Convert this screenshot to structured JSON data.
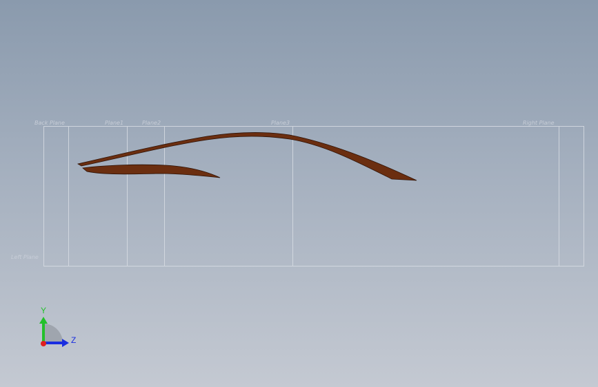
{
  "viewport": {
    "plane_labels": {
      "back": "Back Plane",
      "plane1": "Plane1",
      "plane2": "Plane2",
      "plane3": "Plane3",
      "right": "Right Plane",
      "left": "Left Plane"
    }
  },
  "triad": {
    "y_label": "Y",
    "z_label": "Z"
  },
  "colors": {
    "part_fill": "#6b2e10",
    "part_edge": "#2e1206",
    "plane_line": "#d8dde4",
    "axis_y": "#22c02a",
    "axis_z": "#1a2ee0",
    "axis_x": "#e02020"
  }
}
